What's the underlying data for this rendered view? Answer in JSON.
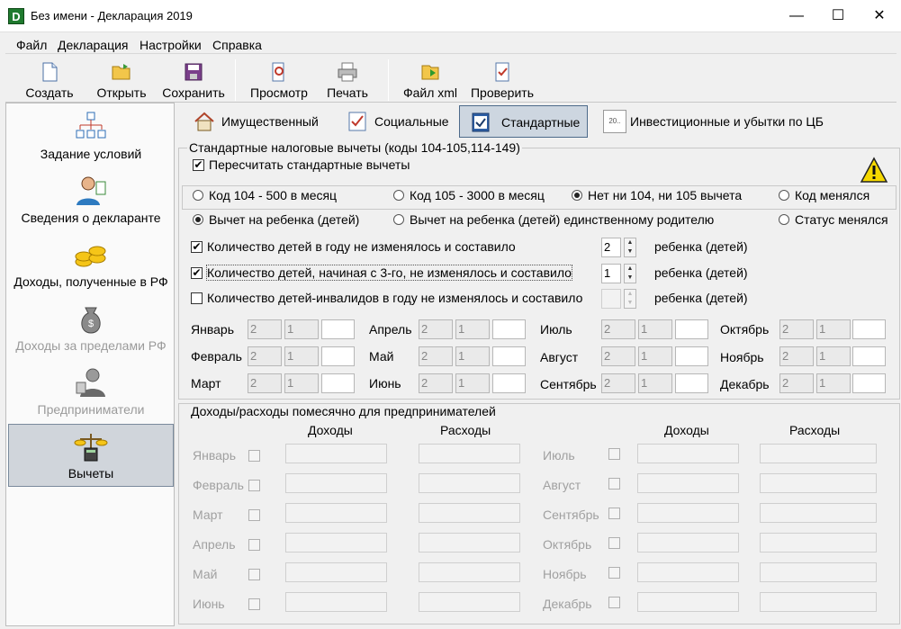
{
  "window": {
    "title": "Без имени - Декларация 2019",
    "app_icon": "D",
    "minimize": "—",
    "maximize": "☐",
    "close": "✕"
  },
  "menu": [
    "Файл",
    "Декларация",
    "Настройки",
    "Справка"
  ],
  "toolbar": [
    "Создать",
    "Открыть",
    "Сохранить",
    "Просмотр",
    "Печать",
    "Файл xml",
    "Проверить"
  ],
  "sidebar": [
    "Задание условий",
    "Сведения о декларанте",
    "Доходы, полученные в РФ",
    "Доходы за пределами РФ",
    "Предприниматели",
    "Вычеты"
  ],
  "tabs": [
    "Имущественный",
    "Социальные",
    "Стандартные",
    "Инвестиционные и убытки по ЦБ"
  ],
  "tab4_icon_text": "20..",
  "standard": {
    "group_title": "Стандартные налоговые вычеты (коды 104-105,114-149)",
    "recalc_label": "Пересчитать стандартные вычеты",
    "radio_row1": [
      "Код 104 - 500 в месяц",
      "Код 105 - 3000 в месяц",
      "Нет ни 104, ни 105 вычета",
      "Код менялся"
    ],
    "radio_row2": [
      "Вычет на ребенка (детей)",
      "Вычет на ребенка (детей) единственному родителю",
      "Статус менялся"
    ],
    "children": [
      {
        "label": "Количество детей в году не изменялось и составило",
        "value": "2",
        "unit": "ребенка (детей)"
      },
      {
        "label": "Количество детей, начиная с 3-го, не изменялось и составило",
        "value": "1",
        "unit": "ребенка (детей)"
      },
      {
        "label": "Количество детей-инвалидов в году не изменялось и составило",
        "value": "",
        "unit": "ребенка (детей)"
      }
    ],
    "months": [
      "Январь",
      "Февраль",
      "Март",
      "Апрель",
      "Май",
      "Июнь",
      "Июль",
      "Август",
      "Сентябрь",
      "Октябрь",
      "Ноябрь",
      "Декабрь"
    ],
    "month_v1": "2",
    "month_v2": "1"
  },
  "entrepreneur": {
    "title": "Доходы/расходы помесячно для предпринимателей",
    "col_income": "Доходы",
    "col_expense": "Расходы",
    "months": [
      "Январь",
      "Февраль",
      "Март",
      "Апрель",
      "Май",
      "Июнь",
      "Июль",
      "Август",
      "Сентябрь",
      "Октябрь",
      "Ноябрь",
      "Декабрь"
    ]
  },
  "colors": {
    "accent": "#1f7a2e",
    "active_tab": "#cdd6e0",
    "active_sidebar": "#d0d5db",
    "warning": "#f5d800"
  }
}
